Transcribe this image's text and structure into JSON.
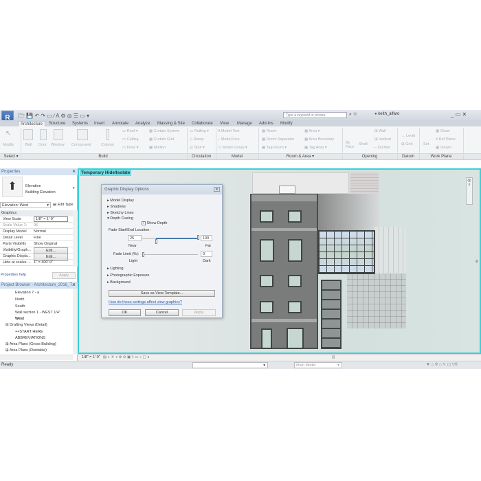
{
  "titlebar": {
    "search_placeholder": "Type a keyword or phrase",
    "user": "keith_alfaro",
    "logo": "R"
  },
  "tabs": [
    "Architecture",
    "Structure",
    "Systems",
    "Insert",
    "Annotate",
    "Analyze",
    "Massing & Site",
    "Collaborate",
    "View",
    "Manage",
    "Add-Ins",
    "Modify"
  ],
  "ribbon": {
    "select": [
      "Modify"
    ],
    "build": [
      "Wall",
      "Door",
      "Window",
      "Component",
      "Column",
      "Roof",
      "Ceiling",
      "Floor",
      "Curtain System",
      "Curtain Grid",
      "Mullion"
    ],
    "circulation": [
      "Railing",
      "Ramp",
      "Stair"
    ],
    "model": [
      "Model Text",
      "Model Line",
      "Model Group"
    ],
    "room_area": [
      "Room",
      "Room Separator",
      "Tag Room",
      "Area",
      "Area Boundary",
      "Tag Area"
    ],
    "opening": [
      "By Face",
      "Shaft",
      "Wall",
      "Vertical",
      "Dormer"
    ],
    "datum": [
      "Level",
      "Grid"
    ],
    "work_plane": [
      "Set",
      "Show",
      "Ref Plane",
      "Viewer"
    ],
    "panels": [
      "Select",
      "Build",
      "Circulation",
      "Model",
      "Room & Area",
      "Opening",
      "Datum",
      "Work Plane"
    ]
  },
  "properties": {
    "title": "Properties",
    "type_name": "Elevation",
    "type_sub": "Building Elevation",
    "selector": "Elevation: West",
    "edit_type": "Edit Type",
    "group": "Graphics",
    "rows": [
      [
        "View Scale",
        "1/8\" = 1'-0\""
      ],
      [
        "Scale Value    1:",
        "96"
      ],
      [
        "Display Model",
        "Normal"
      ],
      [
        "Detail Level",
        "Fine"
      ],
      [
        "Parts Visibility",
        "Show Original"
      ],
      [
        "Visibility/Graph...",
        "Edit..."
      ],
      [
        "Graphic Displa...",
        "Edit..."
      ],
      [
        "Hide at scales ...",
        "1\" = 400'-0\""
      ]
    ],
    "help": "Properties help",
    "apply": "Apply"
  },
  "browser": {
    "title": "Project Browser - Architecture_2016_T...",
    "items": [
      "Elevation 7 - a",
      "North",
      "South",
      "Wall section 1 - WEST 1/4\"",
      "West",
      "Drafting Views (Detail)",
      "++START HERE",
      "ABBREVIATIONS",
      "Area Plans (Gross Building)",
      "Area Plans (Rentable)"
    ]
  },
  "view": {
    "temp_label": "Temporary Hide/Isolate",
    "scale": "1/8\" = 1'-0\""
  },
  "status": {
    "text": "Ready",
    "model": "Main Model",
    "filter_count": "0"
  },
  "dialog": {
    "title": "Graphic Display Options",
    "sections": [
      "Model Display",
      "Shadows",
      "Sketchy Lines",
      "Depth Cueing",
      "Lighting",
      "Photographic Exposure",
      "Background"
    ],
    "show_depth": "Show Depth",
    "show_depth_checked": true,
    "fade_label": "Fade Start/End Location:",
    "near_value": "25",
    "far_value": "100",
    "near": "Near",
    "far": "Far",
    "fade_limit_label": "Fade Limit (%):",
    "fade_limit_value": "0",
    "light": "Light",
    "dark": "Dark",
    "save_template": "Save as View Template...",
    "help_link": "How do these settings affect view graphics?",
    "ok": "OK",
    "cancel": "Cancel",
    "apply": "Apply"
  },
  "colors": {
    "accent": "#3ccfd8",
    "link": "#2a5db0"
  }
}
